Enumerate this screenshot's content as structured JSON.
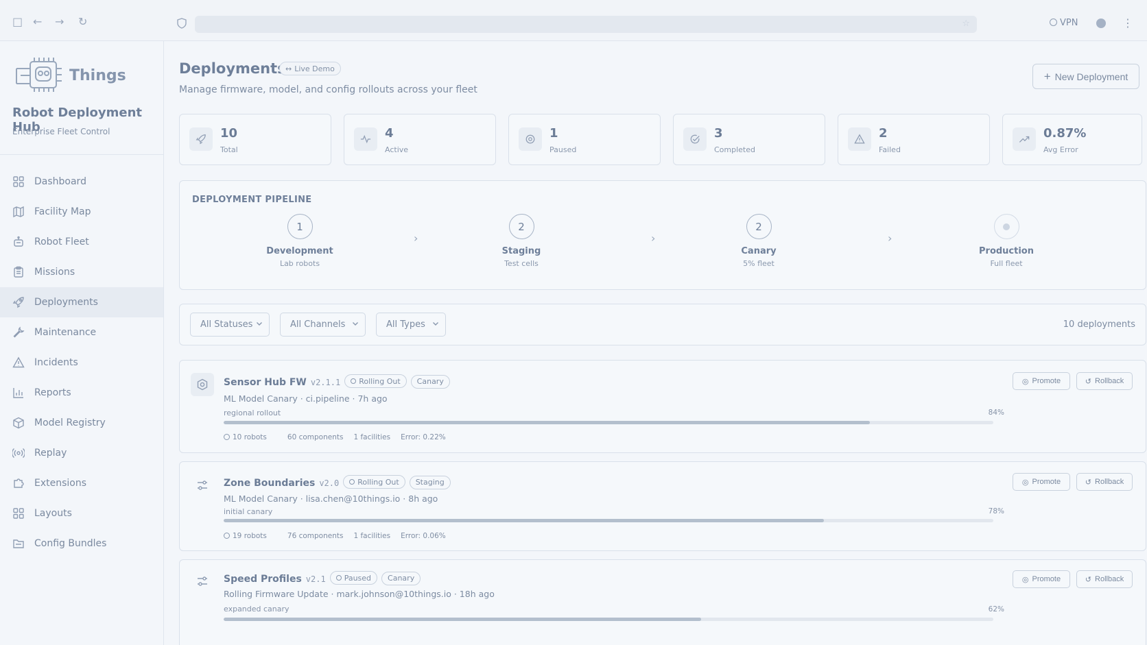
{
  "browser": {
    "vpn_label": "VPN"
  },
  "brand": {
    "logo_text": "Things",
    "hub_title": "Robot Deployment Hub",
    "hub_subtitle": "Enterprise Fleet Control"
  },
  "sidebar": {
    "items": [
      {
        "label": "Dashboard",
        "icon": "grid-icon"
      },
      {
        "label": "Facility Map",
        "icon": "map-icon"
      },
      {
        "label": "Robot Fleet",
        "icon": "robot-icon"
      },
      {
        "label": "Missions",
        "icon": "clipboard-icon"
      },
      {
        "label": "Deployments",
        "icon": "rocket-icon",
        "active": true
      },
      {
        "label": "Maintenance",
        "icon": "wrench-icon"
      },
      {
        "label": "Incidents",
        "icon": "alert-icon"
      },
      {
        "label": "Reports",
        "icon": "bar-chart-icon"
      },
      {
        "label": "Model Registry",
        "icon": "cube-icon"
      },
      {
        "label": "Replay",
        "icon": "broadcast-icon"
      },
      {
        "label": "Extensions",
        "icon": "puzzle-icon"
      },
      {
        "label": "Layouts",
        "icon": "layout-icon"
      },
      {
        "label": "Config Bundles",
        "icon": "folder-icon"
      }
    ]
  },
  "header": {
    "title": "Deployments",
    "badge": "Live Demo",
    "subtitle": "Manage firmware, model, and config rollouts across your fleet",
    "new_button": "New Deployment"
  },
  "stats": [
    {
      "value": "10",
      "label": "Total",
      "icon": "rocket-icon"
    },
    {
      "value": "4",
      "label": "Active",
      "icon": "activity-icon"
    },
    {
      "value": "1",
      "label": "Paused",
      "icon": "pause-icon"
    },
    {
      "value": "3",
      "label": "Completed",
      "icon": "check-circle-icon"
    },
    {
      "value": "2",
      "label": "Failed",
      "icon": "warning-icon"
    },
    {
      "value": "0.87%",
      "label": "Avg Error",
      "icon": "trend-up-icon"
    }
  ],
  "pipeline": {
    "title": "DEPLOYMENT PIPELINE",
    "stages": [
      {
        "count": "1",
        "name": "Development",
        "desc": "Lab robots"
      },
      {
        "count": "2",
        "name": "Staging",
        "desc": "Test cells"
      },
      {
        "count": "2",
        "name": "Canary",
        "desc": "5% fleet"
      },
      {
        "count": "",
        "name": "Production",
        "desc": "Full fleet"
      }
    ]
  },
  "filters": {
    "status": "All Statuses",
    "channel": "All Channels",
    "type": "All Types",
    "count": "10 deployments"
  },
  "deployments": [
    {
      "name": "Sensor Hub FW",
      "version": "v2.1.1",
      "status": "Rolling Out",
      "channel": "Canary",
      "meta": "ML Model Canary · ci.pipeline · 7h ago",
      "note": "regional rollout",
      "progress": 84,
      "progress_label": "84%",
      "robots": "10 robots",
      "components": "60 components",
      "facilities": "1 facilities",
      "error": "Error: 0.22%",
      "promote": "Promote",
      "rollback": "Rollback"
    },
    {
      "name": "Zone Boundaries",
      "version": "v2.0",
      "status": "Rolling Out",
      "channel": "Staging",
      "meta": "ML Model Canary · lisa.chen@10things.io · 8h ago",
      "note": "initial canary",
      "progress": 78,
      "progress_label": "78%",
      "robots": "19 robots",
      "components": "76 components",
      "facilities": "1 facilities",
      "error": "Error: 0.06%",
      "promote": "Promote",
      "rollback": "Rollback"
    },
    {
      "name": "Speed Profiles",
      "version": "v2.1",
      "status": "Paused",
      "channel": "Canary",
      "meta": "Rolling Firmware Update · mark.johnson@10things.io · 18h ago",
      "note": "expanded canary",
      "progress": 62,
      "progress_label": "62%",
      "promote": "Promote",
      "rollback": "Rollback"
    }
  ]
}
